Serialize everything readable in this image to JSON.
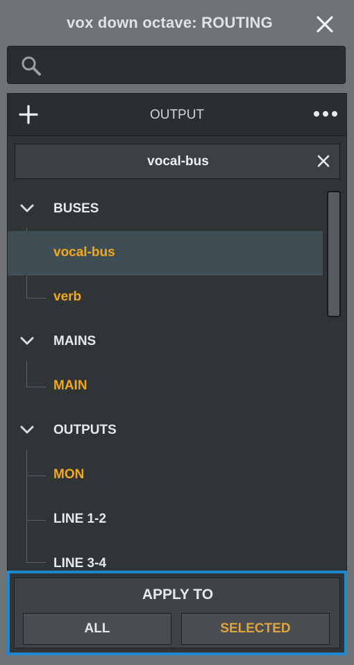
{
  "window": {
    "title": "vox down octave: ROUTING"
  },
  "search": {
    "value": "",
    "placeholder": ""
  },
  "output": {
    "header_label": "OUTPUT",
    "selected_value": "vocal-bus"
  },
  "tree": {
    "groups": [
      {
        "label": "BUSES",
        "expanded": true,
        "items": [
          {
            "label": "vocal-bus",
            "highlight": true,
            "active": true
          },
          {
            "label": "verb",
            "highlight": true,
            "active": false
          }
        ]
      },
      {
        "label": "MAINS",
        "expanded": true,
        "items": [
          {
            "label": "MAIN",
            "highlight": true,
            "active": false
          }
        ]
      },
      {
        "label": "OUTPUTS",
        "expanded": true,
        "items": [
          {
            "label": "MON",
            "highlight": true,
            "active": false
          },
          {
            "label": "LINE 1-2",
            "highlight": false,
            "active": false
          },
          {
            "label": "LINE 3-4",
            "highlight": false,
            "active": false
          }
        ]
      }
    ]
  },
  "apply": {
    "title": "APPLY TO",
    "all_label": "ALL",
    "selected_label": "SELECTED"
  },
  "colors": {
    "accent_orange": "#f2a81d",
    "focus_blue": "#1e88d2",
    "active_row": "#3f4d55"
  },
  "icons": {
    "close": "close-icon",
    "search": "search-icon",
    "add": "plus-icon",
    "more": "more-icon",
    "clear": "clear-icon",
    "chevron": "chevron-down-icon"
  }
}
